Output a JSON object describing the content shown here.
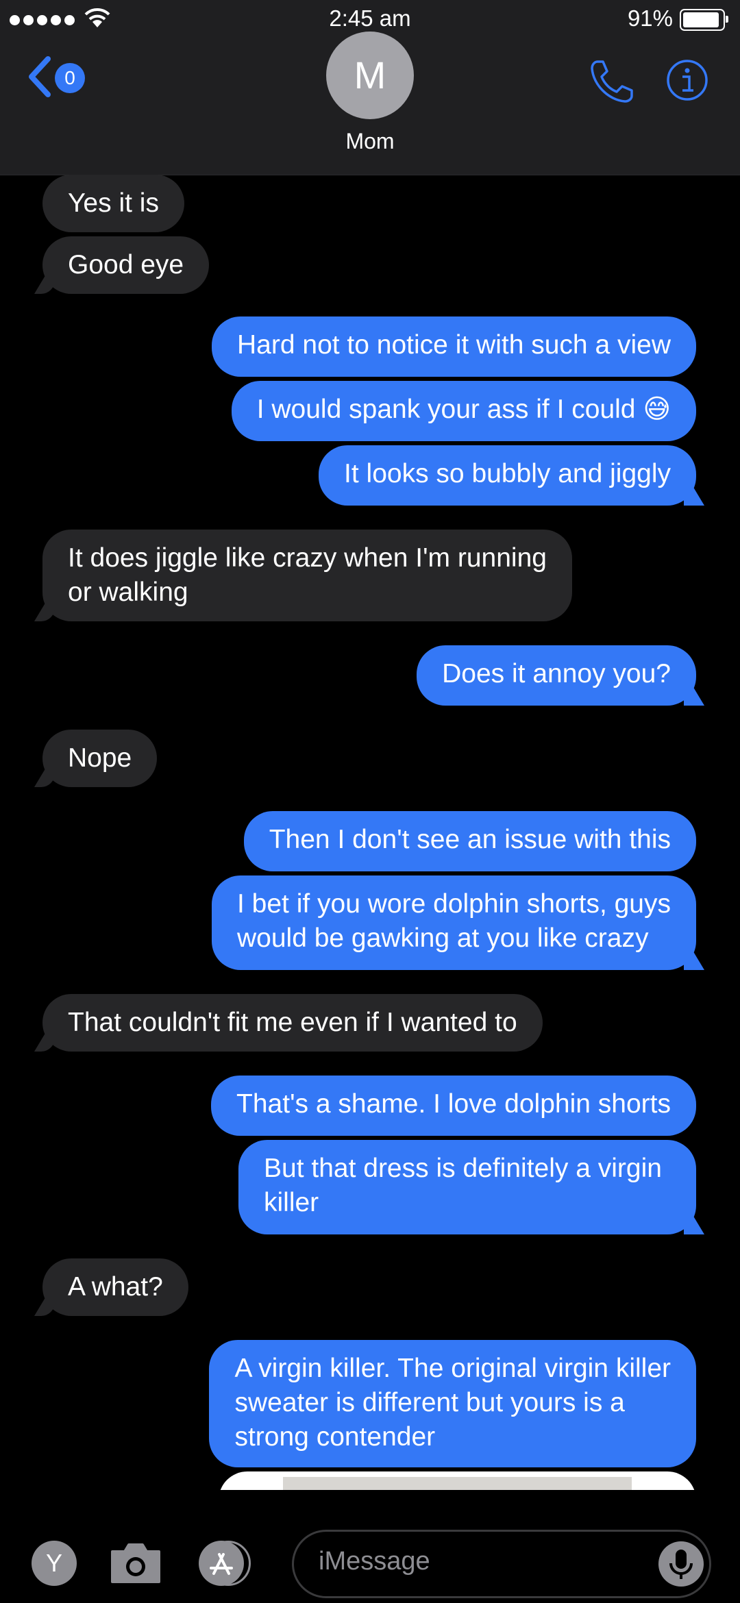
{
  "status_bar": {
    "time": "2:45 am",
    "battery": "91%"
  },
  "header": {
    "back_badge": "0",
    "avatar_initial": "M",
    "contact_name": "Mom"
  },
  "messages": [
    {
      "from": "them",
      "text": "Yes it is"
    },
    {
      "from": "them",
      "text": "Good eye"
    },
    {
      "from": "me",
      "text": "Hard not to notice it with such a view"
    },
    {
      "from": "me",
      "text": "I would spank your ass if I could 😅"
    },
    {
      "from": "me",
      "text": "It looks so bubbly and jiggly"
    },
    {
      "from": "them",
      "line1": "It does jiggle like crazy when I'm running",
      "line2": "or walking"
    },
    {
      "from": "me",
      "text": "Does it annoy you?"
    },
    {
      "from": "them",
      "text": "Nope"
    },
    {
      "from": "me",
      "text": "Then I don't see an issue with this"
    },
    {
      "from": "me",
      "line1": "I bet if you wore dolphin shorts, guys",
      "line2": "would be gawking at you like crazy"
    },
    {
      "from": "them",
      "text": "That couldn't fit me even if I wanted to"
    },
    {
      "from": "me",
      "text": "That's a shame. I love dolphin shorts"
    },
    {
      "from": "me",
      "line1": "But that dress is definitely a virgin",
      "line2": "killer"
    },
    {
      "from": "them",
      "text": "A what?"
    },
    {
      "from": "me",
      "line1": "A virgin killer. The original virgin killer",
      "line2": "sweater is different but yours is a",
      "line3": "strong contender"
    }
  ],
  "composer": {
    "app_badge": "Y",
    "placeholder": "iMessage"
  },
  "colors": {
    "outgoing": "#3478f6",
    "incoming": "#262628",
    "background": "#000000"
  }
}
